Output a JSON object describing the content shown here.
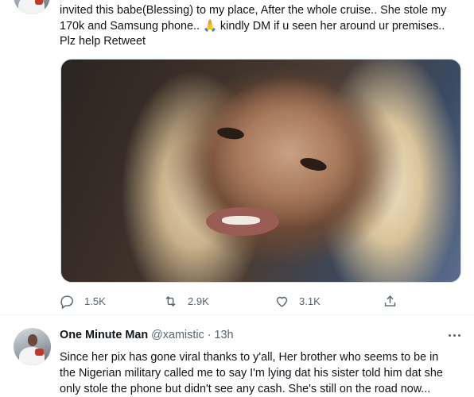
{
  "tweet1": {
    "lines": [
      "invited this babe(Blessing) to my place, After the whole cruise.. She stole my",
      "170k and Samsung phone.. 🙏 kindly DM if u seen her around ur premises..",
      "Plz help Retweet"
    ],
    "actions": {
      "replies": "1.5K",
      "retweets": "2.9K",
      "likes": "3.1K"
    }
  },
  "tweet2": {
    "name": "One Minute Man",
    "handle": "@xamistic",
    "separator": "·",
    "time": "13h",
    "lines": [
      "Since her pix has gone viral thanks to y'all, Her brother who seems to be in",
      "the Nigerian military called me to say I'm lying dat his sister told him dat she",
      "only stole the phone but didn't see any cash. She's still on the road now..."
    ]
  }
}
